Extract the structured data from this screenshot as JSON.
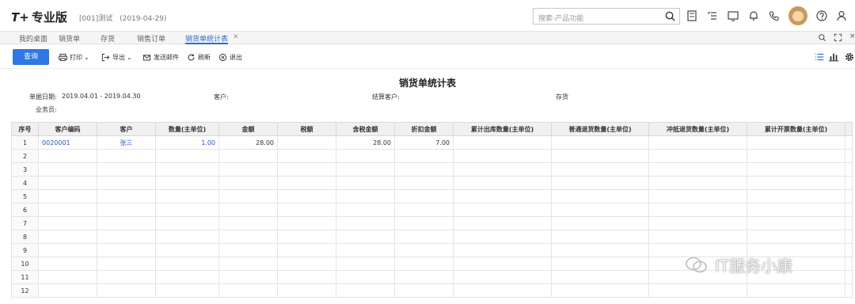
{
  "app": {
    "logo": "T+",
    "edition": "专业版",
    "company": "[001]测试",
    "date": "(2019-04-29)"
  },
  "search": {
    "placeholder": "搜索-产品功能"
  },
  "top_icons": [
    "calculator-icon",
    "tasks-icon",
    "monitor-icon",
    "bell-icon",
    "phone-icon",
    "avatar",
    "help-icon",
    "user-icon"
  ],
  "tabs": [
    {
      "label": "我的桌面"
    },
    {
      "label": "销货单"
    },
    {
      "label": "存货"
    },
    {
      "label": "销售订单"
    },
    {
      "label": "销货单统计表",
      "active": true
    }
  ],
  "toolbar": {
    "query": "查询",
    "print": "打印",
    "export": "导出",
    "email": "发送邮件",
    "refresh": "刷新",
    "exit": "退出"
  },
  "report": {
    "title": "销货单统计表",
    "doc_date_label": "单据日期:",
    "doc_date_value": "2019.04.01 - 2019.04.30",
    "customer_label": "客户:",
    "settle_customer_label": "结算客户:",
    "inventory_label": "存货",
    "salesman_label": "业务员:"
  },
  "grid": {
    "columns": [
      "序号",
      "客户编码",
      "客户",
      "数量(主单位)",
      "金额",
      "税额",
      "含税金额",
      "折扣金额",
      "累计出库数量(主单位)",
      "普通退货数量(主单位)",
      "冲抵退货数量(主单位)",
      "累计开票数量(主单位)"
    ],
    "rows": [
      {
        "no": "1",
        "code": "0020001",
        "customer": "张三",
        "qty": "1.00",
        "amount": "28.00",
        "tax": "",
        "tax_amount": "28.00",
        "discount": "7.00",
        "out_qty": "",
        "return_qty": "",
        "offset_qty": "",
        "invoice_qty": ""
      },
      {
        "no": "2"
      },
      {
        "no": "3"
      },
      {
        "no": "4"
      },
      {
        "no": "5"
      },
      {
        "no": "6"
      },
      {
        "no": "7"
      },
      {
        "no": "8"
      },
      {
        "no": "9"
      },
      {
        "no": "10"
      },
      {
        "no": "11"
      },
      {
        "no": "12"
      }
    ]
  },
  "watermark": {
    "text": "IT服务小康"
  },
  "colors": {
    "primary": "#2f77e3",
    "link": "#2b55c8",
    "header_bg": "#f0f0f0"
  }
}
